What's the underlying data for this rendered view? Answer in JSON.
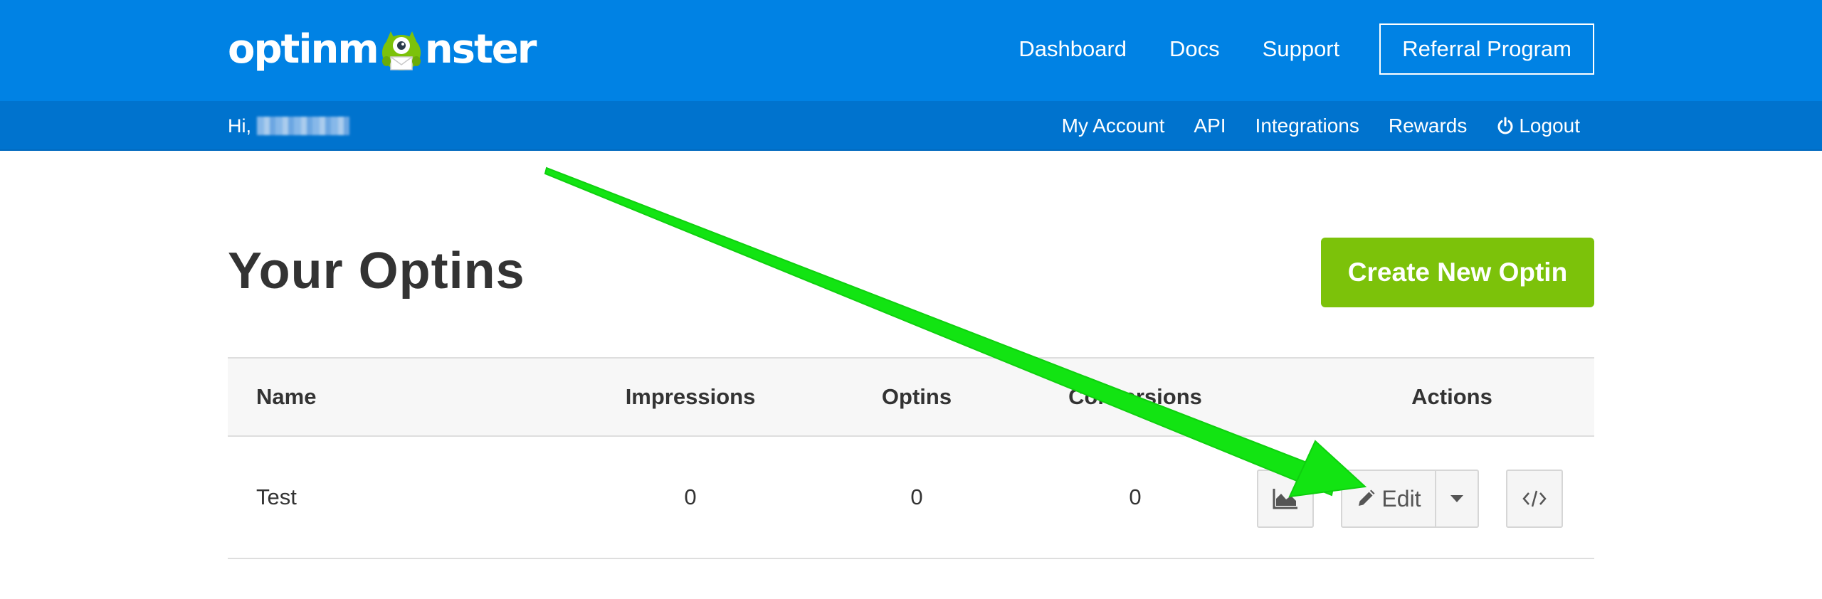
{
  "brand": {
    "logo_prefix": "optinm",
    "logo_suffix": "nster",
    "primary_color": "#0082E4",
    "secondary_color": "#0073CE",
    "accent_color": "#7CC20A",
    "logo_icon": "monster-mascot-icon"
  },
  "nav_main": {
    "dashboard": "Dashboard",
    "docs": "Docs",
    "support": "Support",
    "referral": "Referral Program"
  },
  "subbar": {
    "greeting": "Hi,",
    "account": "My Account",
    "api": "API",
    "integrations": "Integrations",
    "rewards": "Rewards",
    "logout": "Logout",
    "logout_icon": "power-icon"
  },
  "main": {
    "title": "Your Optins",
    "create_button": "Create New Optin"
  },
  "table": {
    "headers": {
      "name": "Name",
      "impressions": "Impressions",
      "optins": "Optins",
      "conversions": "Conversions",
      "actions": "Actions"
    },
    "rows": [
      {
        "name": "Test",
        "impressions": "0",
        "optins": "0",
        "conversions": "0"
      }
    ],
    "actions": {
      "stats_icon": "area-chart-icon",
      "edit_label": "Edit",
      "edit_icon": "pencil-icon",
      "dropdown_icon": "caret-down-icon",
      "embed_icon": "code-icon"
    }
  },
  "annotation": {
    "color": "#12E412",
    "icon": "arrow-icon"
  }
}
